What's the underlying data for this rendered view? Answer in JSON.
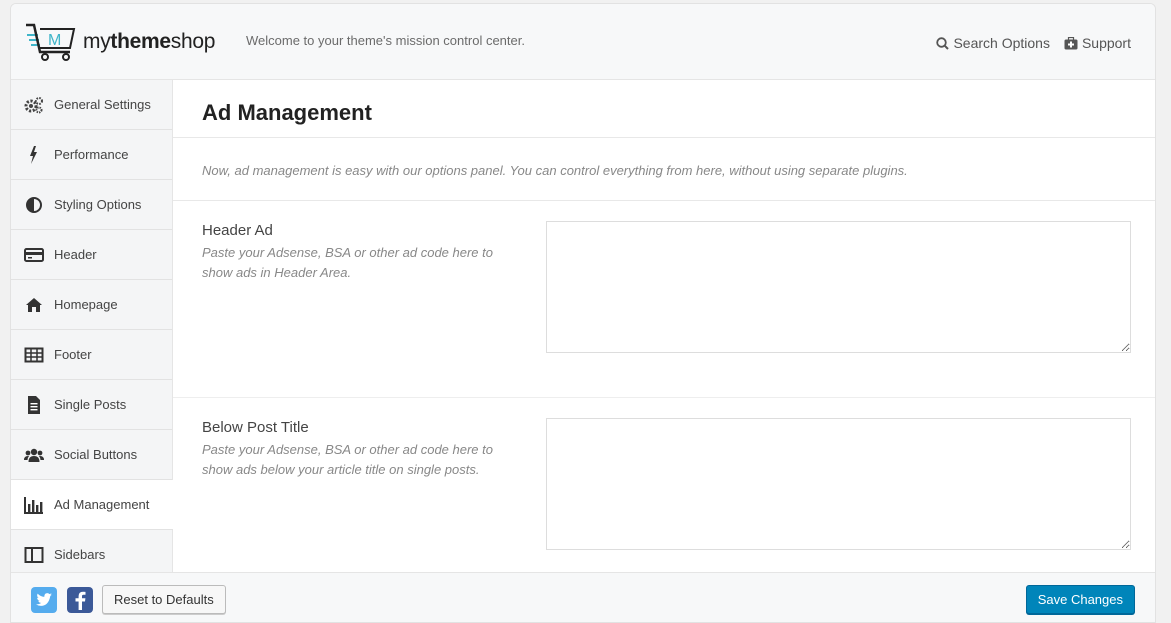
{
  "header": {
    "brand_light": "my",
    "brand_bold": "theme",
    "brand_end": "shop",
    "tagline": "Welcome to your theme's mission control center.",
    "search_label": "Search Options",
    "support_label": "Support"
  },
  "sidebar": {
    "items": [
      {
        "label": "General Settings",
        "icon": "gears-icon"
      },
      {
        "label": "Performance",
        "icon": "bolt-icon"
      },
      {
        "label": "Styling Options",
        "icon": "contrast-icon"
      },
      {
        "label": "Header",
        "icon": "credit-card-icon"
      },
      {
        "label": "Homepage",
        "icon": "home-icon"
      },
      {
        "label": "Footer",
        "icon": "table-icon"
      },
      {
        "label": "Single Posts",
        "icon": "document-icon"
      },
      {
        "label": "Social Buttons",
        "icon": "users-icon"
      },
      {
        "label": "Ad Management",
        "icon": "bar-chart-icon"
      },
      {
        "label": "Sidebars",
        "icon": "columns-icon"
      }
    ],
    "active": "Ad Management"
  },
  "main": {
    "title": "Ad Management",
    "description": "Now, ad management is easy with our options panel. You can control everything from here, without using separate plugins.",
    "options": [
      {
        "title": "Header Ad",
        "help": "Paste your Adsense, BSA or other ad code here to show ads in Header Area.",
        "value": ""
      },
      {
        "title": "Below Post Title",
        "help": "Paste your Adsense, BSA or other ad code here to show ads below your article title on single posts.",
        "value": ""
      }
    ]
  },
  "footer": {
    "reset_label": "Reset to Defaults",
    "save_label": "Save Changes"
  },
  "colors": {
    "accent": "#0085ba",
    "logo_teal": "#3fb5c9",
    "twitter": "#55acee",
    "facebook": "#3b5998"
  }
}
